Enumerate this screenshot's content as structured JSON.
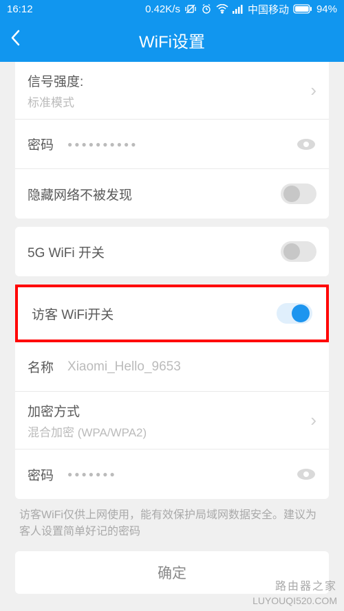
{
  "status": {
    "time": "16:12",
    "speed": "0.42K/s",
    "carrier": "中国移动",
    "battery": "94%"
  },
  "header": {
    "title": "WiFi设置"
  },
  "signal": {
    "label": "信号强度:",
    "mode": "标准模式"
  },
  "password": {
    "label": "密码",
    "masked": "●●●●●●●●●●"
  },
  "hide_network": {
    "label": "隐藏网络不被发现"
  },
  "wifi5g": {
    "label": "5G WiFi 开关"
  },
  "guest": {
    "switch_label": "访客 WiFi开关",
    "name_label": "名称",
    "name_value": "Xiaomi_Hello_9653",
    "encryption_label": "加密方式",
    "encryption_value": "混合加密 (WPA/WPA2)",
    "password_label": "密码",
    "password_masked": "●●●●●●●"
  },
  "help_text": "访客WiFi仅供上网使用，能有效保护局域网数据安全。建议为客人设置简单好记的密码",
  "confirm": "确定",
  "watermark": {
    "line1": "路由器之家",
    "line2": "LUYOUQI520.COM"
  }
}
